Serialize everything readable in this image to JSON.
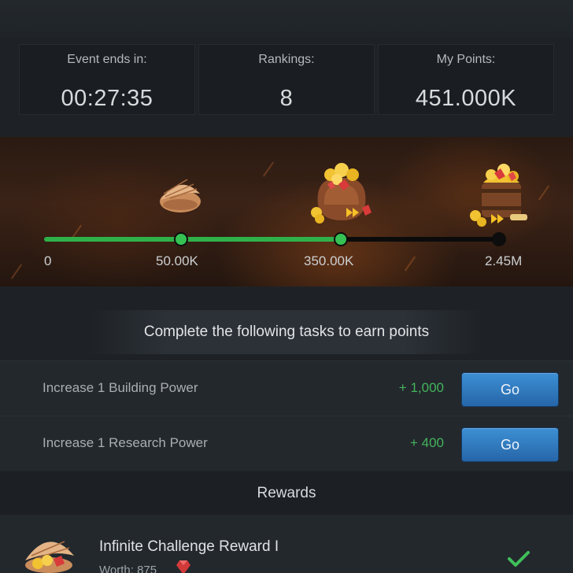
{
  "stats": {
    "event_ends_label": "Event ends in:",
    "event_ends_value": "00:27:35",
    "rankings_label": "Rankings:",
    "rankings_value": "8",
    "points_label": "My Points:",
    "points_value": "451.000K"
  },
  "progress": {
    "milestones": [
      "0",
      "50.00K",
      "350.00K",
      "2.45M"
    ],
    "milestone_values": [
      0,
      50000,
      350000,
      2450000
    ],
    "current_points": 451000,
    "reward_icons": [
      "clam-shell-icon",
      "treasure-sack-icon",
      "treasure-barrel-icon"
    ]
  },
  "tasks": {
    "heading": "Complete the following tasks to earn points",
    "items": [
      {
        "name": "Increase 1 Building Power",
        "points": "+ 1,000",
        "button": "Go"
      },
      {
        "name": "Increase 1 Research Power",
        "points": "+ 400",
        "button": "Go"
      }
    ]
  },
  "rewards": {
    "heading": "Rewards",
    "items": [
      {
        "title": "Infinite Challenge Reward I",
        "worth": "Worth: 875",
        "icon": "gem-icon",
        "status": "check-icon"
      }
    ]
  },
  "colors": {
    "progress_green": "#2fb14a",
    "points_green": "#43b35b",
    "button_blue": "#2f7bc2"
  }
}
